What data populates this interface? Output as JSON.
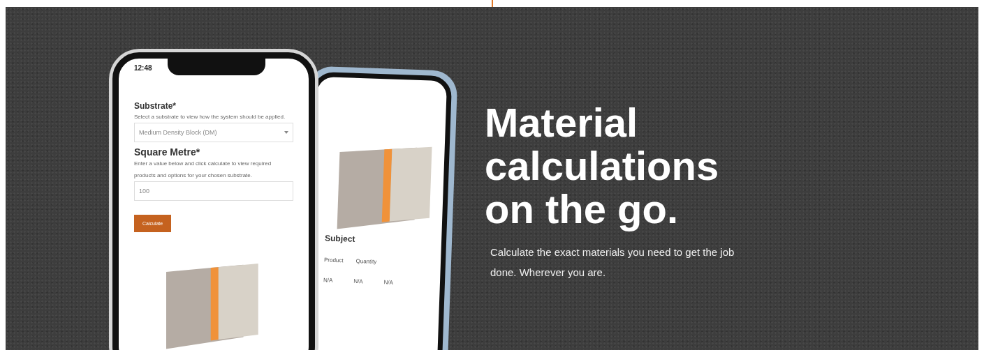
{
  "hero": {
    "heading": "Material calculations on the go.",
    "subtext": "Calculate the exact materials you need to get the job done. Wherever you are."
  },
  "front_phone": {
    "time": "12:48",
    "substrate_label": "Substrate*",
    "substrate_help": "Select a substrate to view how the system should be applied.",
    "substrate_value": "Medium Density Block (DM)",
    "area_label": "Square Metre*",
    "area_help": "Enter a value below and click calculate to view required products and options for your chosen substrate.",
    "area_value": "100",
    "button": "Calculate"
  },
  "back_phone": {
    "heading": "Subject",
    "columns": [
      "Product",
      "Quantity"
    ],
    "cells": [
      "N/A",
      "N/A",
      "N/A"
    ]
  }
}
